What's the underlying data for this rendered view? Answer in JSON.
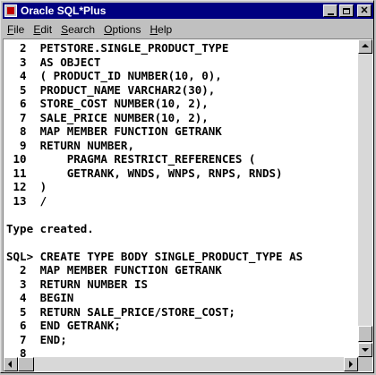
{
  "window": {
    "title": "Oracle SQL*Plus"
  },
  "menu": [
    {
      "key": "F",
      "rest": "ile"
    },
    {
      "key": "E",
      "rest": "dit"
    },
    {
      "key": "S",
      "rest": "earch"
    },
    {
      "key": "O",
      "rest": "ptions"
    },
    {
      "key": "H",
      "rest": "elp"
    }
  ],
  "console": {
    "lines": [
      "  2  PETSTORE.SINGLE_PRODUCT_TYPE",
      "  3  AS OBJECT",
      "  4  ( PRODUCT_ID NUMBER(10, 0),",
      "  5  PRODUCT_NAME VARCHAR2(30),",
      "  6  STORE_COST NUMBER(10, 2),",
      "  7  SALE_PRICE NUMBER(10, 2),",
      "  8  MAP MEMBER FUNCTION GETRANK",
      "  9  RETURN NUMBER,",
      " 10      PRAGMA RESTRICT_REFERENCES (",
      " 11      GETRANK, WNDS, WNPS, RNPS, RNDS)",
      " 12  )",
      " 13  /",
      "",
      "Type created.",
      "",
      "SQL> CREATE TYPE BODY SINGLE_PRODUCT_TYPE AS",
      "  2  MAP MEMBER FUNCTION GETRANK",
      "  3  RETURN NUMBER IS",
      "  4  BEGIN",
      "  5  RETURN SALE_PRICE/STORE_COST;",
      "  6  END GETRANK;",
      "  7  END;",
      "  8"
    ]
  }
}
